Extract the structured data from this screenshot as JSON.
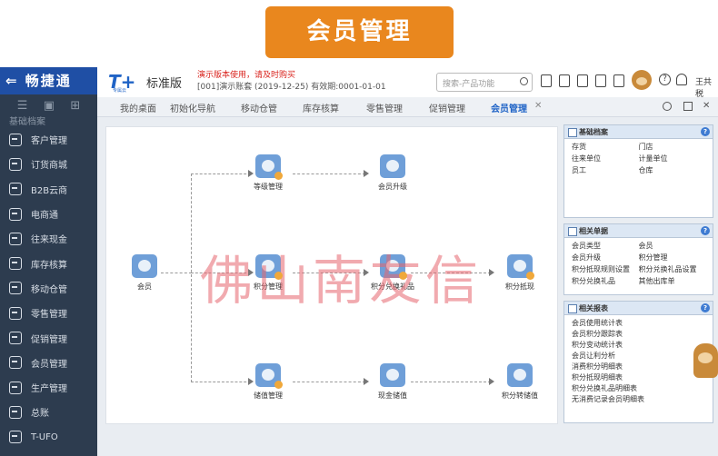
{
  "banner": {
    "title": "会员管理"
  },
  "sidebar": {
    "brand": "⇐ 畅捷通",
    "partial_item": "基础档案",
    "items": [
      {
        "label": "客户管理"
      },
      {
        "label": "订货商城"
      },
      {
        "label": "B2B云商"
      },
      {
        "label": "电商通"
      },
      {
        "label": "往来现金"
      },
      {
        "label": "库存核算"
      },
      {
        "label": "移动仓管"
      },
      {
        "label": "零售管理"
      },
      {
        "label": "促销管理"
      },
      {
        "label": "会员管理"
      },
      {
        "label": "生产管理"
      },
      {
        "label": "总账"
      },
      {
        "label": "T-UFO"
      }
    ]
  },
  "header": {
    "logo": "T+",
    "logo_sub": "专属云",
    "edition": "标准版",
    "warning": "演示版本使用，请及时购买",
    "account": "[001]演示账套    (2019-12-25)   有效期:0001-01-01",
    "search_placeholder": "搜索-产品功能",
    "user": "王共税"
  },
  "tabs": [
    {
      "label": "我的桌面"
    },
    {
      "label": "初始化导航"
    },
    {
      "label": "移动仓管"
    },
    {
      "label": "库存核算"
    },
    {
      "label": "零售管理"
    },
    {
      "label": "促销管理"
    },
    {
      "label": "会员管理"
    }
  ],
  "flow": {
    "nodes": {
      "member": "会员",
      "level": "等级管理",
      "upgrade": "会员升级",
      "points": "积分管理",
      "redeem_gift": "积分兑换礼品",
      "points_deduct": "积分抵现",
      "stored_value": "储值管理",
      "cash_store": "现金储值",
      "points_to_store": "积分转储值"
    }
  },
  "watermark": "佛山南友信",
  "panels": {
    "basic": {
      "title": "基础档案",
      "items": [
        "存货",
        "门店",
        "往来单位",
        "计量单位",
        "员工",
        "仓库"
      ]
    },
    "docs": {
      "title": "相关单据",
      "items": [
        "会员类型",
        "会员",
        "会员升级",
        "积分管理",
        "积分抵现规则设置",
        "积分兑换礼品设置",
        "积分兑换礼品",
        "其他出库单"
      ]
    },
    "reports": {
      "title": "相关报表",
      "items": [
        "会员使用统计表",
        "会员积分跟踪表",
        "积分变动统计表",
        "会员让利分析",
        "消费积分明细表",
        "积分抵现明细表",
        "积分兑换礼品明细表",
        "无消费记录会员明细表"
      ]
    }
  }
}
